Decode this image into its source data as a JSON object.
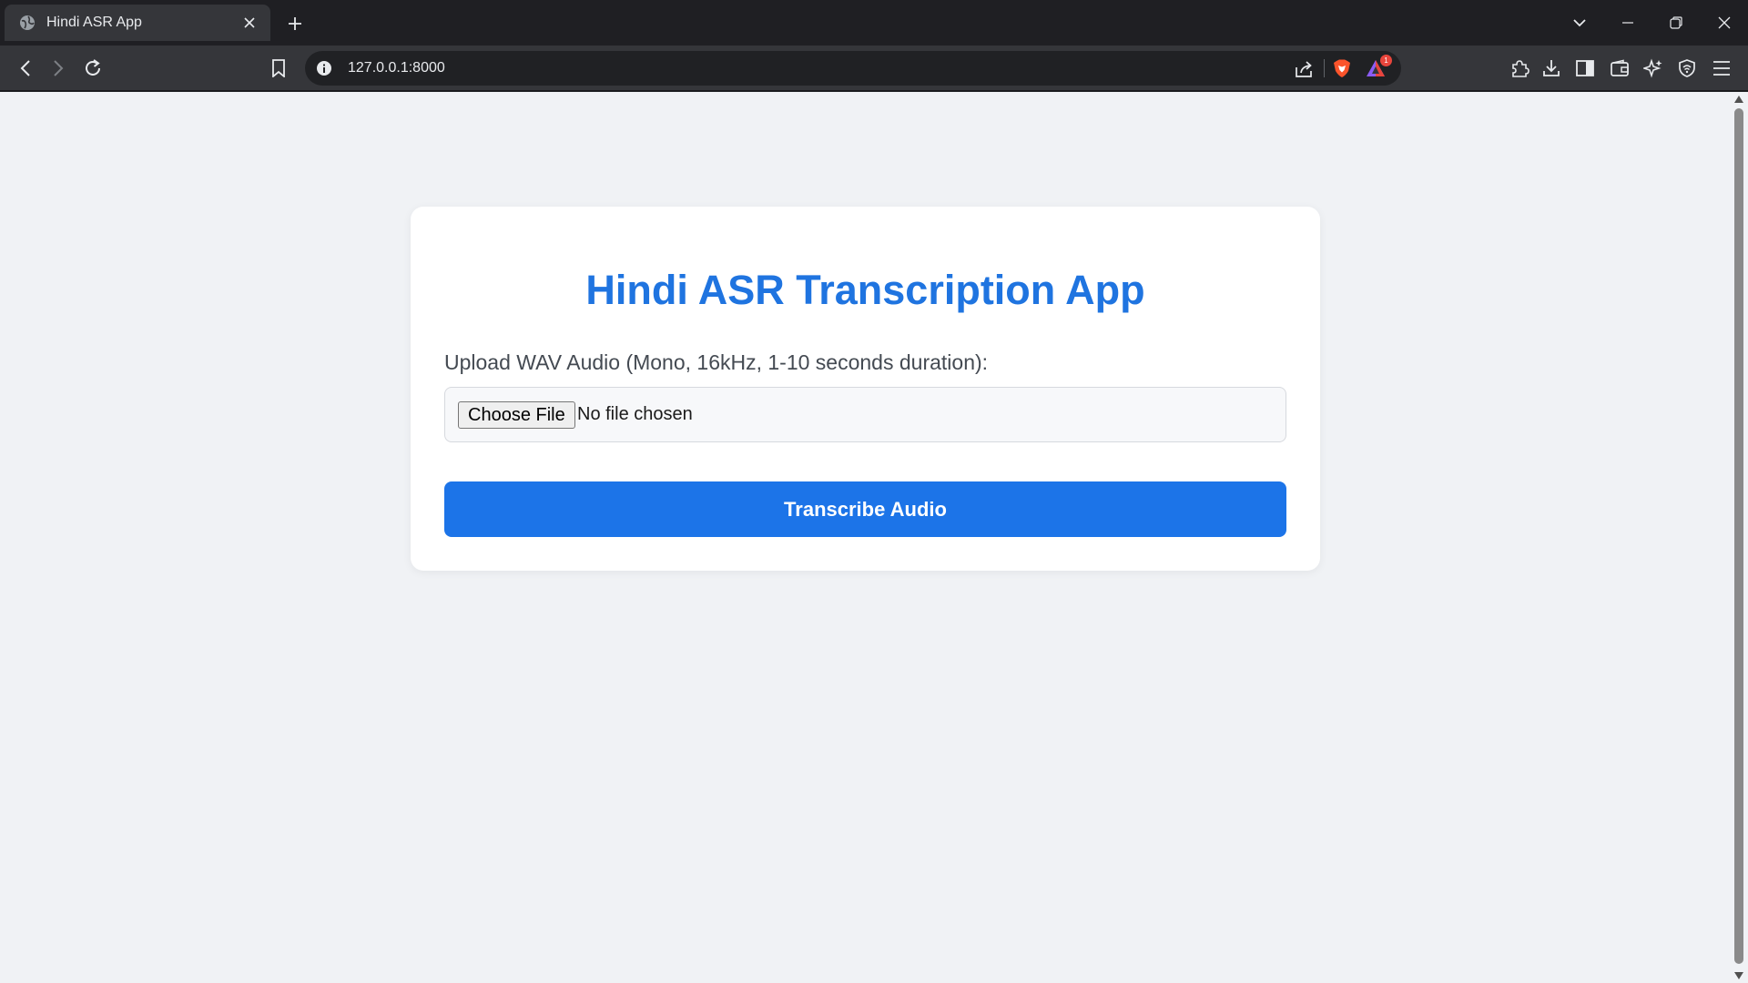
{
  "browser": {
    "tab_title": "Hindi ASR App",
    "url": "127.0.0.1:8000",
    "rewards_badge": "1"
  },
  "page": {
    "title": "Hindi ASR Transcription App",
    "upload_label": "Upload WAV Audio (Mono, 16kHz, 1-10 seconds duration):",
    "choose_file_label": "Choose File",
    "file_status": "No file chosen",
    "submit_label": "Transcribe Audio"
  },
  "colors": {
    "accent": "#1c74e8",
    "title": "#1f74e0",
    "page_bg": "#f0f2f5"
  },
  "icons": [
    "globe-icon",
    "close-icon",
    "plus-icon",
    "chevron-down-icon",
    "minimize-icon",
    "restore-icon",
    "back-icon",
    "forward-icon",
    "reload-icon",
    "bookmark-icon",
    "info-icon",
    "share-icon",
    "brave-shield-icon",
    "rewards-icon",
    "extensions-icon",
    "download-icon",
    "sidebar-icon",
    "wallet-icon",
    "leo-ai-icon",
    "vpn-icon",
    "menu-icon"
  ]
}
